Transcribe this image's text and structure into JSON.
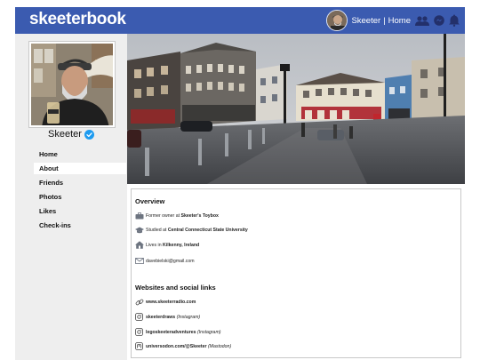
{
  "brand": {
    "logo": "skeeterbook"
  },
  "topnav": {
    "profile_link": "Skeeter",
    "separator": "|",
    "home_link": "Home",
    "icons": [
      "friends-icon",
      "messenger-icon",
      "notifications-bell-icon"
    ]
  },
  "profile": {
    "name": "Skeeter",
    "verified_icon": "verified-check-icon"
  },
  "sidebar": {
    "items": [
      {
        "label": "Home"
      },
      {
        "label": "About",
        "active": true
      },
      {
        "label": "Friends"
      },
      {
        "label": "Photos"
      },
      {
        "label": "Likes"
      },
      {
        "label": "Check-ins"
      }
    ]
  },
  "about": {
    "overview_title": "Overview",
    "work": {
      "prefix": "Former owner at",
      "place": "Skeeter's Toybox"
    },
    "education": {
      "prefix": "Studied at",
      "place": "Central Connecticut State University"
    },
    "home": {
      "prefix": "Lives in",
      "place": "Kilkenny, Ireland"
    },
    "email": "davebielski@gmail.com",
    "websites_title": "Websites and social links",
    "links": [
      {
        "handle": "www.skeeterradio.com",
        "network": "",
        "icon": "link-icon"
      },
      {
        "handle": "skeeterdraws",
        "network": "(Instagram)",
        "icon": "instagram-icon"
      },
      {
        "handle": "legoskeeteradventures",
        "network": "(Instagram)",
        "icon": "instagram-icon"
      },
      {
        "handle": "universodon.com/@Skeeter",
        "network": "(Mastodon)",
        "icon": "mastodon-icon"
      }
    ]
  },
  "colors": {
    "topbar": "#3b5bb0",
    "sidebar_bg": "#eeeeee",
    "verified": "#1d9bf0",
    "nav_icon": "#23306b"
  }
}
